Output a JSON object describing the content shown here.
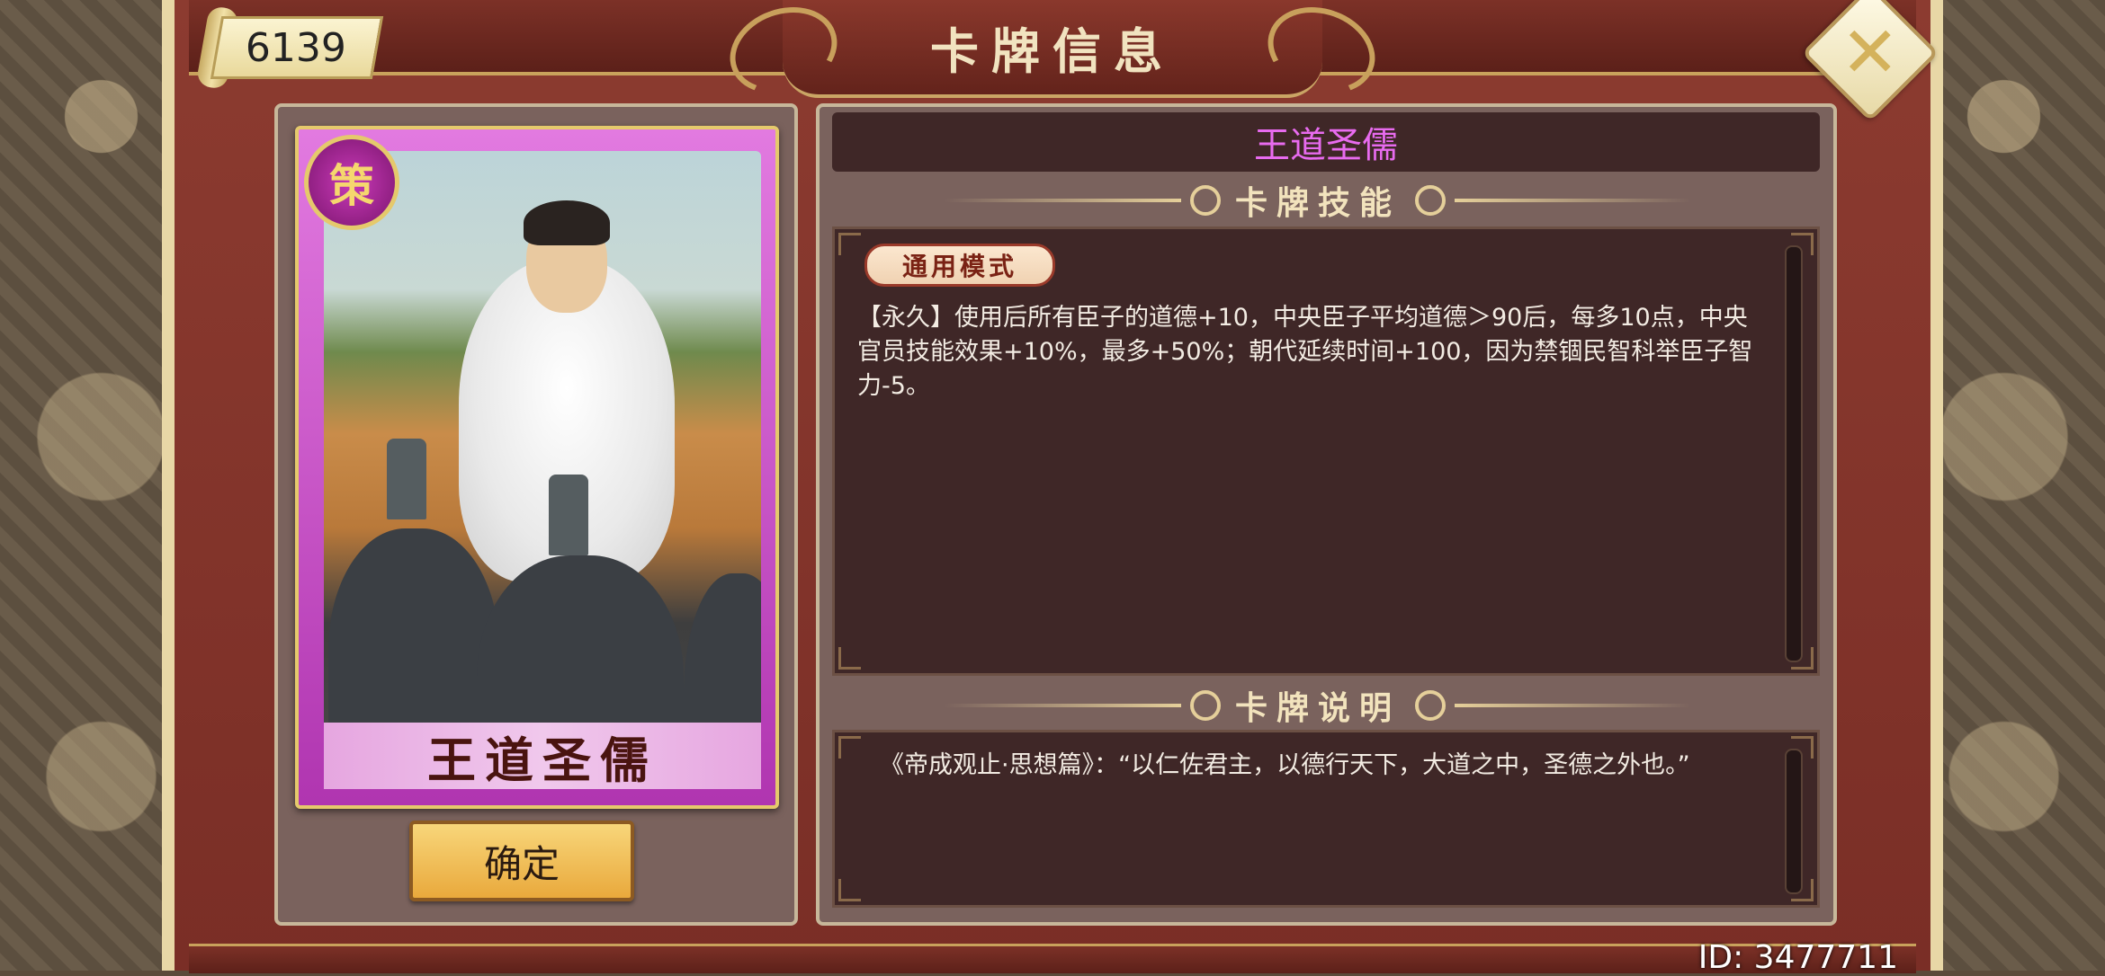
{
  "header": {
    "title": "卡牌信息",
    "coin_value": "6139",
    "close_symbol": "✕"
  },
  "card": {
    "name_banner": "王道圣儒",
    "medal_char": "策",
    "confirm_label": "确定"
  },
  "detail": {
    "card_name": "王道圣儒",
    "skill_heading": "卡牌技能",
    "mode_tag": "通用模式",
    "skill_text": "【永久】使用后所有臣子的道德+10，中央臣子平均道德＞90后，每多10点，中央官员技能效果+10%，最多+50%；朝代延续时间+100，因为禁锢民智科举臣子智力-5。",
    "desc_heading": "卡牌说明",
    "desc_text": "《帝成观止·思想篇》：“以仁佐君主，以德行天下，大道之中，圣德之外也。”"
  },
  "footer": {
    "id_label": "ID: 3477711"
  },
  "colors": {
    "card_name_accent": "#e86bef",
    "panel_dark": "#3f2727",
    "frame_red": "#7c3127",
    "gold": "#e5c96c"
  }
}
